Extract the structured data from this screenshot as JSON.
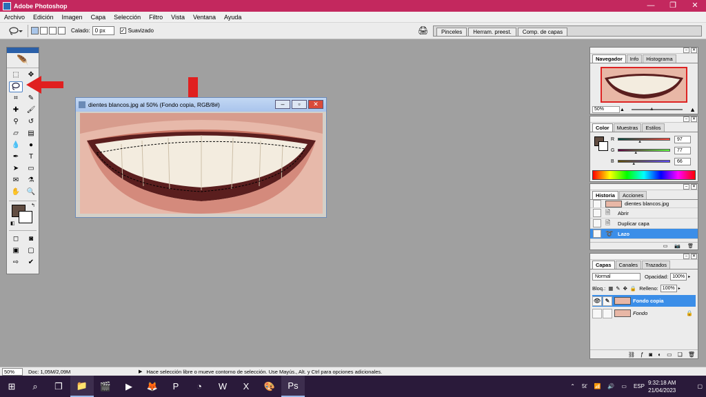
{
  "app": {
    "title": "Adobe Photoshop",
    "window_controls": [
      "—",
      "❐",
      "✕"
    ]
  },
  "menu": [
    "Archivo",
    "Edición",
    "Imagen",
    "Capa",
    "Selección",
    "Filtro",
    "Vista",
    "Ventana",
    "Ayuda"
  ],
  "options_bar": {
    "feather_label": "Calado:",
    "feather_value": "0 px",
    "antialias_label": "Suavizado",
    "antialias_checked": true,
    "palette_well_tabs": [
      "Pinceles",
      "Herram. preest.",
      "Comp. de capas"
    ]
  },
  "toolbox": {
    "selected_tool": "lasso-tool",
    "foreground_color": "#614d42",
    "background_color": "#ffffff",
    "tool_icons": [
      "marquee-icon",
      "move-icon",
      "lasso-icon",
      "magic-wand-icon",
      "crop-icon",
      "slice-icon",
      "healing-brush-icon",
      "brush-icon",
      "clone-stamp-icon",
      "history-brush-icon",
      "eraser-icon",
      "gradient-icon",
      "blur-icon",
      "dodge-icon",
      "pen-icon",
      "type-icon",
      "path-selection-icon",
      "shape-icon",
      "notes-icon",
      "eyedropper-icon",
      "hand-icon",
      "zoom-icon"
    ]
  },
  "annotations": {
    "arrow_color": "#e02020"
  },
  "document": {
    "title": "dientes blancos.jpg al 50% (Fondo copia, RGB/8#)"
  },
  "navigator": {
    "tabs": [
      "Navegador",
      "Info",
      "Histograma"
    ],
    "active_tab": "Navegador",
    "zoom": "50%"
  },
  "color": {
    "tabs": [
      "Color",
      "Muestras",
      "Estilos"
    ],
    "active_tab": "Color",
    "channels": [
      {
        "label": "R",
        "value": "97",
        "fraction": 0.38
      },
      {
        "label": "G",
        "value": "77",
        "fraction": 0.3
      },
      {
        "label": "B",
        "value": "66",
        "fraction": 0.26
      }
    ]
  },
  "history": {
    "tabs": [
      "Historia",
      "Acciones"
    ],
    "active_tab": "Historia",
    "snapshot": "dientes blancos.jpg",
    "items": [
      {
        "label": "Abrir",
        "active": false
      },
      {
        "label": "Duplicar capa",
        "active": false
      },
      {
        "label": "Lazo",
        "active": true
      }
    ]
  },
  "layers": {
    "tabs": [
      "Capas",
      "Canales",
      "Trazados"
    ],
    "active_tab": "Capas",
    "blend_mode": "Normal",
    "opacity_label": "Opacidad:",
    "opacity": "100%",
    "lock_label": "Bloq.:",
    "fill_label": "Relleno:",
    "fill": "100%",
    "items": [
      {
        "name": "Fondo copia",
        "active": true,
        "visible": true,
        "locked": false
      },
      {
        "name": "Fondo",
        "active": false,
        "visible": false,
        "locked": true
      }
    ]
  },
  "status_bar": {
    "zoom": "50%",
    "doc_size": "Doc: 1,05M/2,09M",
    "hint": "Hace selección libre o mueve contorno de selección. Use Mayús., Alt. y Ctrl para opciones adicionales."
  },
  "taskbar": {
    "language": "ESP",
    "time": "9:32:18 AM",
    "date": "21/04/2023"
  }
}
